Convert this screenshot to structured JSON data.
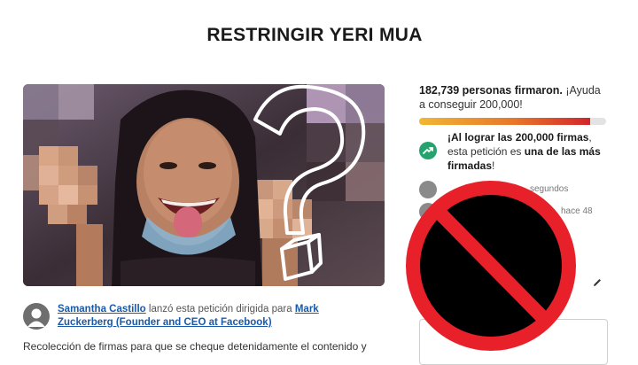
{
  "page": {
    "title": "RESTRINGIR YERI MUA"
  },
  "petition": {
    "starter_name": "Samantha Castillo",
    "starter_action": " lanzó esta petición dirigida para ",
    "target_name": "Mark Zuckerberg (Founder and CEO at Facebook)",
    "description": "Recolección de firmas para que se cheque detenidamente el contenido y"
  },
  "sidebar": {
    "signers_count": "182,739 personas firmaron.",
    "signers_cta": " ¡Ayuda a conseguir 200,000!",
    "progress": 0.914,
    "goal_bold_1": "¡Al lograr las 200,000 firmas",
    "goal_mid": ", esta petición es ",
    "goal_bold_2": "una de las más firmadas",
    "goal_end": "!",
    "recent_signers": [
      {
        "text": "segundos"
      },
      {
        "text": "hace 48"
      }
    ]
  },
  "overlay": {
    "icon": "prohibited-icon",
    "red": "#e8202a"
  },
  "colors": {
    "link": "#1a5aa8",
    "goal_icon": "#25a36f"
  }
}
